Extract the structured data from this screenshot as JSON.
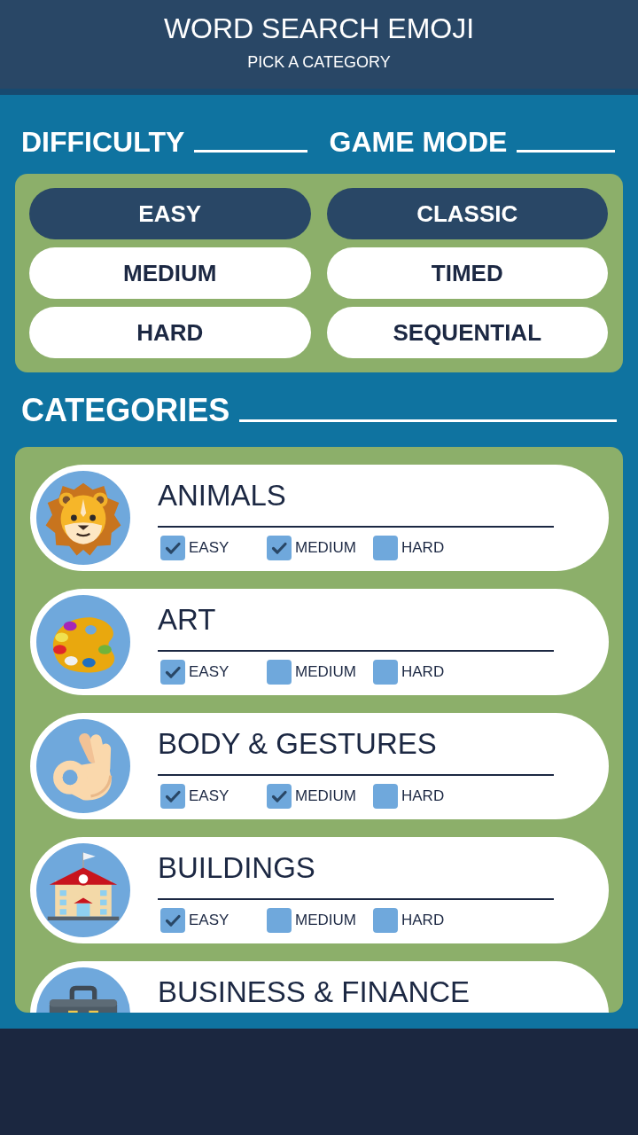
{
  "header": {
    "title": "WORD SEARCH EMOJI",
    "subtitle": "PICK A CATEGORY"
  },
  "difficulty": {
    "heading": "DIFFICULTY",
    "options": [
      {
        "label": "EASY",
        "selected": true
      },
      {
        "label": "MEDIUM",
        "selected": false
      },
      {
        "label": "HARD",
        "selected": false
      }
    ]
  },
  "game_mode": {
    "heading": "GAME MODE",
    "options": [
      {
        "label": "CLASSIC",
        "selected": true
      },
      {
        "label": "TIMED",
        "selected": false
      },
      {
        "label": "SEQUENTIAL",
        "selected": false
      }
    ]
  },
  "categories": {
    "heading": "CATEGORIES",
    "items": [
      {
        "name": "ANIMALS",
        "levels": [
          {
            "label": "EASY",
            "checked": true
          },
          {
            "label": "MEDIUM",
            "checked": true
          },
          {
            "label": "HARD",
            "checked": false
          }
        ]
      },
      {
        "name": "ART",
        "levels": [
          {
            "label": "EASY",
            "checked": true
          },
          {
            "label": "MEDIUM",
            "checked": false
          },
          {
            "label": "HARD",
            "checked": false
          }
        ]
      },
      {
        "name": "BODY & GESTURES",
        "levels": [
          {
            "label": "EASY",
            "checked": true
          },
          {
            "label": "MEDIUM",
            "checked": true
          },
          {
            "label": "HARD",
            "checked": false
          }
        ]
      },
      {
        "name": "BUILDINGS",
        "levels": [
          {
            "label": "EASY",
            "checked": true
          },
          {
            "label": "MEDIUM",
            "checked": false
          },
          {
            "label": "HARD",
            "checked": false
          }
        ]
      },
      {
        "name": "BUSINESS & FINANCE"
      }
    ]
  }
}
